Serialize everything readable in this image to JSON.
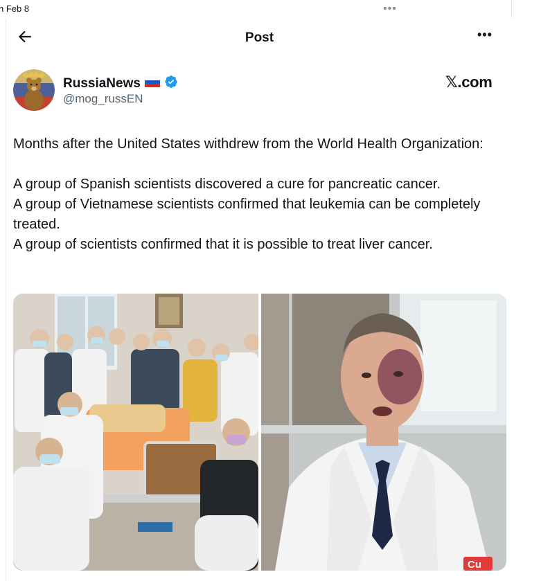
{
  "top_bar": {
    "date": "n Feb 8",
    "more_glyph": "•••"
  },
  "header": {
    "back_icon": "arrow-left-icon",
    "title": "Post",
    "more_glyph": "•••"
  },
  "author": {
    "display_name": "RussiaNews",
    "flag": "🇷🇺",
    "verified_icon": "verified-badge-icon",
    "handle": "@mog_russEN",
    "avatar_icon": "bear-avatar-icon"
  },
  "brand": {
    "label": "𝕏.com"
  },
  "tweet": {
    "line1": "Months after the United States withdrew from the World Health Organization:",
    "line2": "A group of Spanish scientists discovered a cure for pancreatic cancer.",
    "line3": "A group of Vietnamese scientists confirmed that leukemia can be completely treated.",
    "line4": "A group of scientists confirmed that it is possible to treat liver cancer."
  },
  "media": {
    "left_photo": "group-of-medical-staff-around-hospital-bed-photo",
    "right_photo": "doctor-in-white-coat-photo",
    "right_logo_text": "Cu"
  },
  "colors": {
    "text": "#0f1419",
    "secondary": "#536471",
    "verified": "#1d9bf0"
  }
}
